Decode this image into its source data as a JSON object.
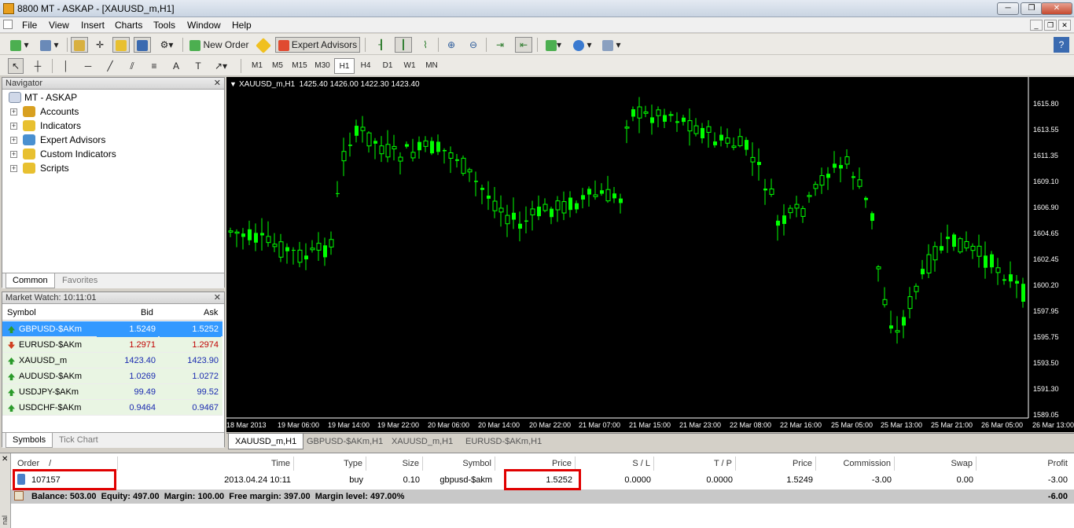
{
  "window": {
    "title": "8800 MT - ASKAP - [XAUUSD_m,H1]",
    "minimize": "─",
    "restore": "❐",
    "close": "✕"
  },
  "menu": [
    "File",
    "View",
    "Insert",
    "Charts",
    "Tools",
    "Window",
    "Help"
  ],
  "toolbar": {
    "new_order": "New Order",
    "expert_advisors": "Expert Advisors"
  },
  "timeframes": [
    "M1",
    "M5",
    "M15",
    "M30",
    "H1",
    "H4",
    "D1",
    "W1",
    "MN"
  ],
  "active_timeframe": "H1",
  "navigator": {
    "title": "Navigator",
    "root": "MT - ASKAP",
    "items": [
      {
        "label": "Accounts",
        "icon": "accounts-icon",
        "color": "#d8a020"
      },
      {
        "label": "Indicators",
        "icon": "indicators-icon",
        "color": "#e8c030"
      },
      {
        "label": "Expert Advisors",
        "icon": "expert-advisors-icon",
        "color": "#4a90d0"
      },
      {
        "label": "Custom Indicators",
        "icon": "custom-indicators-icon",
        "color": "#e8c030"
      },
      {
        "label": "Scripts",
        "icon": "scripts-icon",
        "color": "#e8c030"
      }
    ],
    "tabs": [
      "Common",
      "Favorites"
    ]
  },
  "market_watch": {
    "title": "Market Watch: 10:11:01",
    "headers": {
      "symbol": "Symbol",
      "bid": "Bid",
      "ask": "Ask"
    },
    "rows": [
      {
        "symbol": "GBPUSD-$AKm",
        "bid": "1.5249",
        "ask": "1.5252",
        "dir": "up",
        "selected": true
      },
      {
        "symbol": "EURUSD-$AKm",
        "bid": "1.2971",
        "ask": "1.2974",
        "dir": "down",
        "selected": false
      },
      {
        "symbol": "XAUUSD_m",
        "bid": "1423.40",
        "ask": "1423.90",
        "dir": "up",
        "selected": false
      },
      {
        "symbol": "AUDUSD-$AKm",
        "bid": "1.0269",
        "ask": "1.0272",
        "dir": "up",
        "selected": false
      },
      {
        "symbol": "USDJPY-$AKm",
        "bid": "99.49",
        "ask": "99.52",
        "dir": "up",
        "selected": false
      },
      {
        "symbol": "USDCHF-$AKm",
        "bid": "0.9464",
        "ask": "0.9467",
        "dir": "up",
        "selected": false
      }
    ],
    "tabs": [
      "Symbols",
      "Tick Chart"
    ]
  },
  "chart": {
    "header": "XAUUSD_m,H1  1425.40 1426.00 1422.30 1423.40",
    "price_labels": [
      "1615.80",
      "1613.55",
      "1611.35",
      "1609.10",
      "1606.90",
      "1604.65",
      "1602.45",
      "1600.20",
      "1597.95",
      "1595.75",
      "1593.50",
      "1591.30",
      "1589.05"
    ],
    "time_labels": [
      "18 Mar 2013",
      "19 Mar 06:00",
      "19 Mar 14:00",
      "19 Mar 22:00",
      "20 Mar 06:00",
      "20 Mar 14:00",
      "20 Mar 22:00",
      "21 Mar 07:00",
      "21 Mar 15:00",
      "21 Mar 23:00",
      "22 Mar 08:00",
      "22 Mar 16:00",
      "25 Mar 05:00",
      "25 Mar 13:00",
      "25 Mar 21:00",
      "26 Mar 05:00",
      "26 Mar 13:00"
    ],
    "candle_color": "#00ff00"
  },
  "chart_tabs": [
    "XAUUSD_m,H1",
    "GBPUSD-$AKm,H1",
    "XAUUSD_m,H1",
    "EURUSD-$AKm,H1"
  ],
  "terminal": {
    "headers": [
      "Order",
      "/",
      "Time",
      "Type",
      "Size",
      "Symbol",
      "Price",
      "S / L",
      "T / P",
      "Price",
      "Commission",
      "Swap",
      "Profit"
    ],
    "order": {
      "order": "107157",
      "time": "2013.04.24 10:11",
      "type": "buy",
      "size": "0.10",
      "symbol": "gbpusd-$akm",
      "price": "1.5252",
      "sl": "0.0000",
      "tp": "0.0000",
      "cur_price": "1.5249",
      "commission": "-3.00",
      "swap": "0.00",
      "profit": "-3.00"
    },
    "balance_line": "Balance: 503.00  Equity: 497.00  Margin: 100.00  Free margin: 397.00  Margin level: 497.00%",
    "total_profit": "-6.00",
    "side_label": "nal"
  }
}
